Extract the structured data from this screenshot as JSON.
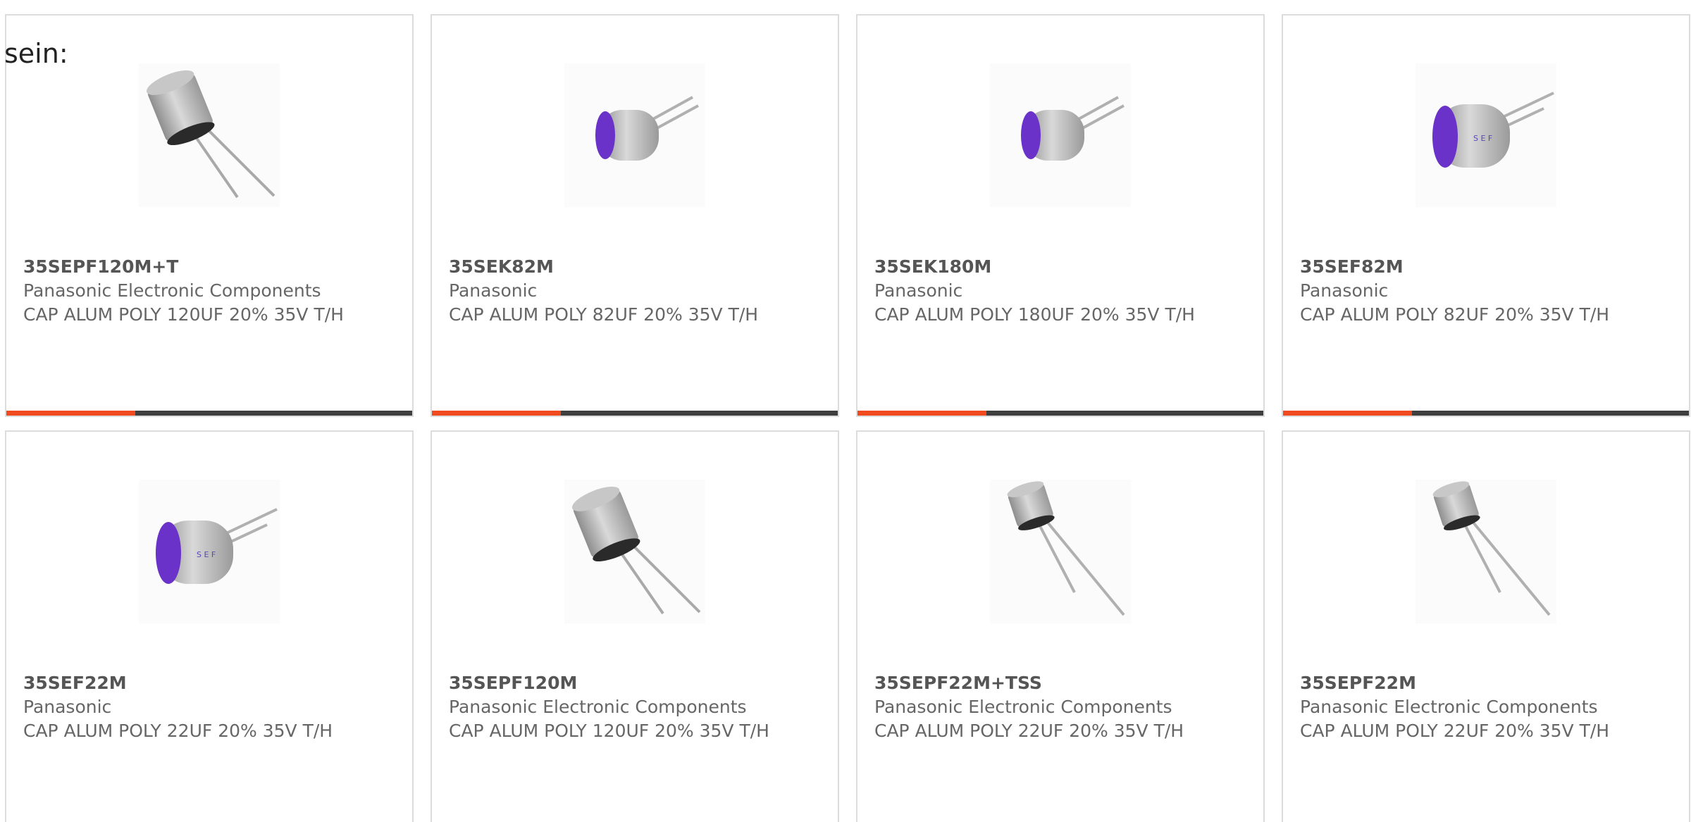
{
  "intro": {
    "text": "sein:"
  },
  "colors": {
    "accent": "#f04a1e",
    "track": "#3f3f3f",
    "card_border": "#dcdcdc",
    "text": "#666666"
  },
  "products": [
    {
      "part": "35SEPF120M+T",
      "maker": "Panasonic Electronic Components",
      "desc": "CAP ALUM POLY 120UF 20% 35V T/H",
      "image": "capacitor-upright-icon",
      "progress": 0.317
    },
    {
      "part": "35SEK82M",
      "maker": "Panasonic",
      "desc": "CAP ALUM POLY 82UF 20% 35V T/H",
      "image": "capacitor-purple-icon",
      "progress": 0.317
    },
    {
      "part": "35SEK180M",
      "maker": "Panasonic",
      "desc": "CAP ALUM POLY 180UF 20% 35V T/H",
      "image": "capacitor-purple-icon",
      "progress": 0.317
    },
    {
      "part": "35SEF82M",
      "maker": "Panasonic",
      "desc": "CAP ALUM POLY 82UF 20% 35V T/H",
      "image": "capacitor-purple-large-icon",
      "progress": 0.317
    },
    {
      "part": "35SEF22M",
      "maker": "Panasonic",
      "desc": "CAP ALUM POLY 22UF 20% 35V T/H",
      "image": "capacitor-purple-large-icon",
      "progress": null
    },
    {
      "part": "35SEPF120M",
      "maker": "Panasonic Electronic Components",
      "desc": "CAP ALUM POLY 120UF 20% 35V T/H",
      "image": "capacitor-upright-icon",
      "progress": null
    },
    {
      "part": "35SEPF22M+TSS",
      "maker": "Panasonic Electronic Components",
      "desc": "CAP ALUM POLY 22UF 20% 35V T/H",
      "image": "capacitor-small-icon",
      "progress": null
    },
    {
      "part": "35SEPF22M",
      "maker": "Panasonic Electronic Components",
      "desc": "CAP ALUM POLY 22UF 20% 35V T/H",
      "image": "capacitor-small-icon",
      "progress": null
    }
  ]
}
